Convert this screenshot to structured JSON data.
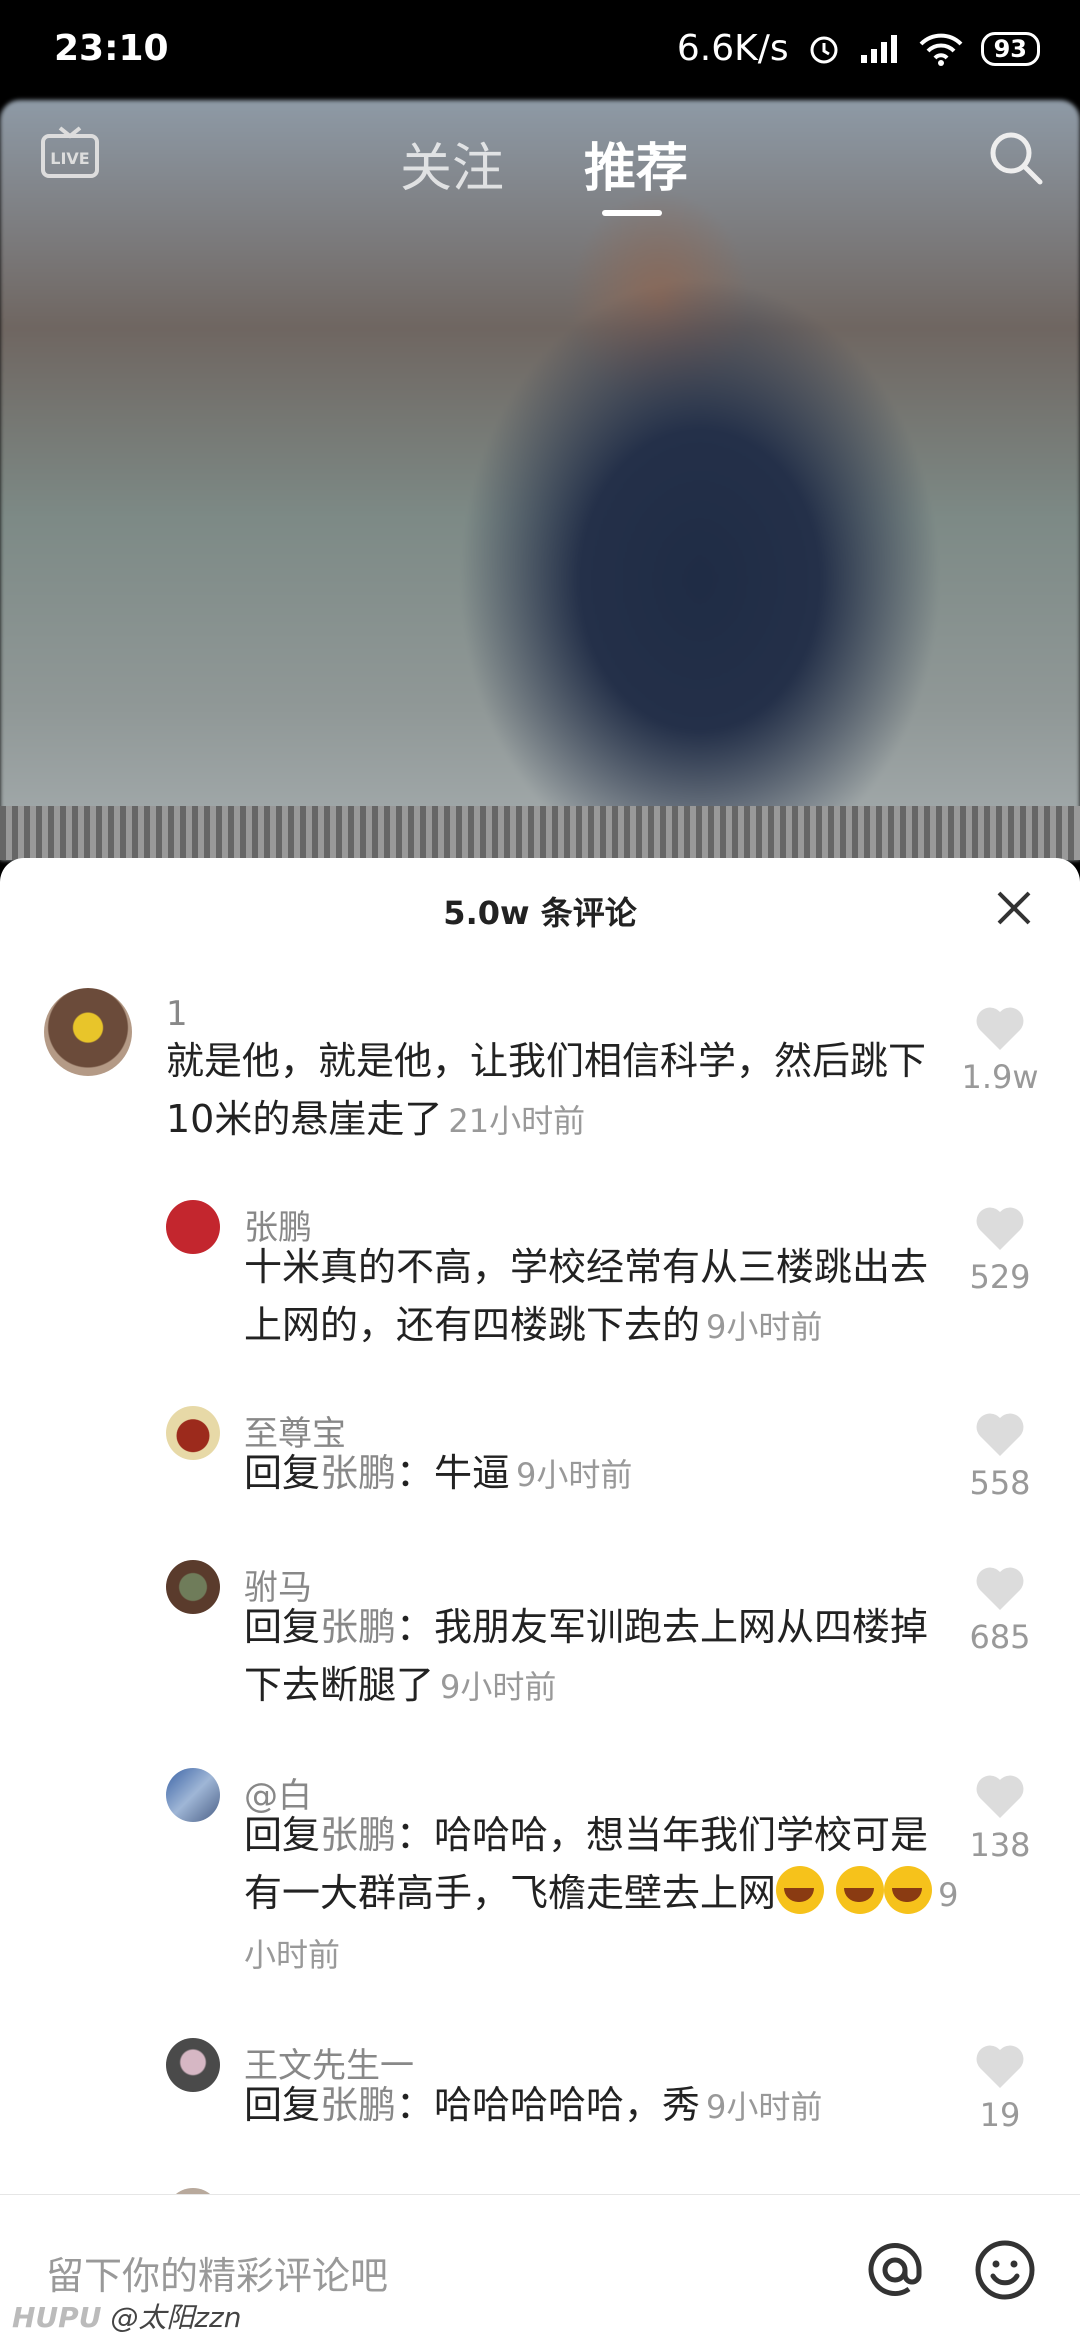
{
  "status": {
    "time": "23:10",
    "speed": "6.6K/s",
    "battery": "93"
  },
  "nav": {
    "follow": "关注",
    "recommend": "推荐"
  },
  "sheet": {
    "title": "5.0w 条评论"
  },
  "comments": [
    {
      "user": "1",
      "text": "就是他，就是他，让我们相信科学，然后跳下10米的悬崖走了",
      "time": "21小时前",
      "likes": "1.9w"
    },
    {
      "user": "张鹏",
      "text": "十米真的不高，学校经常有从三楼跳出去上网的，还有四楼跳下去的",
      "time": "9小时前",
      "likes": "529"
    },
    {
      "user": "至尊宝",
      "reply_prefix": "回复",
      "reply_to": "张鹏",
      "text": "：牛逼",
      "time": "9小时前",
      "likes": "558"
    },
    {
      "user": "驸马",
      "reply_prefix": "回复",
      "reply_to": "张鹏",
      "text": "：我朋友军训跑去上网从四楼掉下去断腿了",
      "time": "9小时前",
      "likes": "685"
    },
    {
      "user": "@白",
      "reply_prefix": "回复",
      "reply_to": "张鹏",
      "text": "：哈哈哈，想当年我们学校可是有一大群高手，飞檐走壁去上网",
      "time": "9小时前",
      "likes": "138"
    },
    {
      "user": "王文先生一",
      "reply_prefix": "回复",
      "reply_to": "张鹏",
      "text": "：哈哈哈哈哈，秀",
      "time": "9小时前",
      "likes": "19"
    }
  ],
  "input": {
    "placeholder": "留下你的精彩评论吧"
  },
  "watermark": {
    "brand": "HUPU",
    "handle": "@太阳zzn"
  },
  "icons": [
    "live-icon",
    "search-icon",
    "close-icon",
    "heart-icon",
    "at-icon",
    "emoji-icon"
  ]
}
